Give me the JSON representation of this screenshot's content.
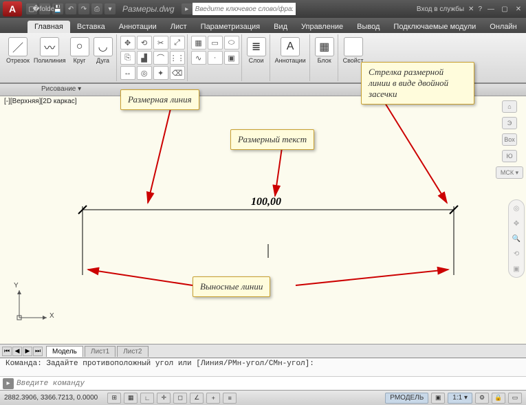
{
  "title": {
    "filename": "Размеры.dwg",
    "search_placeholder": "Введите ключевое слово/фразу",
    "login": "Вход в службы"
  },
  "tabs": [
    "Главная",
    "Вставка",
    "Аннотации",
    "Лист",
    "Параметризация",
    "Вид",
    "Управление",
    "Вывод",
    "Подключаемые модули",
    "Онлайн"
  ],
  "active_tab": 0,
  "ribbon": {
    "tools": {
      "line": "Отрезок",
      "polyline": "Полилиния",
      "circle": "Круг",
      "arc": "Дуга",
      "layers": "Слои",
      "annotation": "Аннотации",
      "block": "Блок",
      "properties": "Свойст"
    },
    "panel_label": "Рисование ▾"
  },
  "canvas": {
    "view_label": "[-][Верхняя][2D каркас]",
    "dim_value": "100,00",
    "ucs_x": "X",
    "ucs_y": "Y"
  },
  "callouts": {
    "dim_line": "Размерная линия",
    "dim_text": "Размерный текст",
    "arrow": "Стрелка размерной линии в виде двойной засечки",
    "ext_lines": "Выносные линии"
  },
  "right_labels": {
    "n": "Э",
    "box": "Box",
    "s": "Ю",
    "wcs": "МСК ▾"
  },
  "sheets": {
    "model": "Модель",
    "s1": "Лист1",
    "s2": "Лист2"
  },
  "command": {
    "history": "Команда: Задайте противоположный угол или [Линия/РМн-угол/СМн-угол]:",
    "placeholder": "Введите команду"
  },
  "status": {
    "coords": "2882.3906, 3366.7213, 0.0000",
    "model_btn": "РМОДЕЛЬ",
    "scale": "1:1 ▾"
  }
}
